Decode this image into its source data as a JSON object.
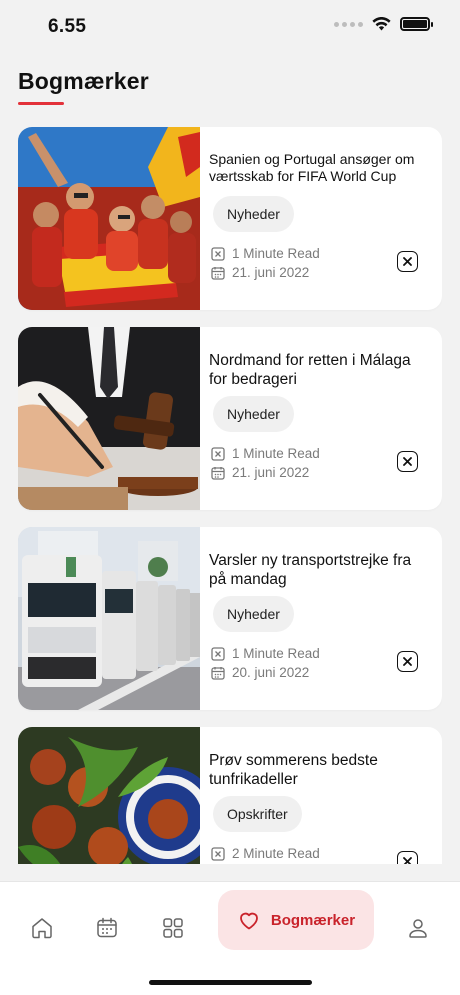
{
  "status_bar": {
    "time": "6.55"
  },
  "header": {
    "title": "Bogmærker"
  },
  "articles": [
    {
      "title": "Spanien og Portugal ansøger om værtsskab for FIFA World Cup",
      "tag": "Nyheder",
      "read_time": "1 Minute Read",
      "date": "21. juni 2022",
      "image": "football-fans"
    },
    {
      "title": "Nordmand for retten i Málaga for bedrageri",
      "tag": "Nyheder",
      "read_time": "1 Minute Read",
      "date": "21. juni 2022",
      "image": "judge-gavel"
    },
    {
      "title": "Varsler ny transportstrejke fra på mandag",
      "tag": "Nyheder",
      "read_time": "1 Minute Read",
      "date": "20. juni 2022",
      "image": "trucks"
    },
    {
      "title": "Prøv sommerens bedste tunfrikadeller",
      "tag": "Opskrifter",
      "read_time": "2 Minute Read",
      "date": "",
      "image": "food"
    }
  ],
  "tabbar": {
    "items": [
      {
        "icon": "home-icon"
      },
      {
        "icon": "calendar-icon"
      },
      {
        "icon": "grid-icon"
      },
      {
        "icon": "heart-icon",
        "label": "Bogmærker",
        "active": true
      },
      {
        "icon": "profile-icon"
      }
    ]
  },
  "colors": {
    "accent": "#e3323a",
    "active_tab_bg": "#fbe4e5",
    "background": "#f2f2f2"
  }
}
